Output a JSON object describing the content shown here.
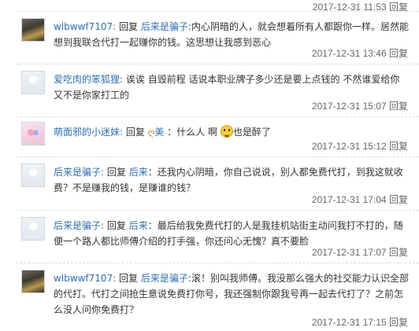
{
  "top_timestamp": "2017-12-31 11:53 回复",
  "replies": [
    {
      "user": "wlbwwf7107:",
      "verb": "回复",
      "target": "后来是骗子",
      "target_suffix": ":",
      "text": "内心阴暗的人，就会想着所有人都跟你一样。居然能想到我联合代打一起赚你的钱。这思想让我感到恶心",
      "time": "2017-12-31 13:46 回复"
    },
    {
      "user": "爱吃肉的笨狐狸:",
      "text": "诶诶 自毁前程 话说本职业牌子多少还是要上点钱的 不然谁爱给你 又不是你家打工的",
      "time": "2017-12-31 15:07 回复"
    },
    {
      "user": "萌面邪的小迷妹:",
      "verb": "回复",
      "target": "美",
      "target_suffix": "：什么人 啊",
      "text_after": "也是醉了",
      "time": "2017-12-31 15:12 回复"
    },
    {
      "user": "后来是骗子:",
      "verb": "回复",
      "target": "后来",
      "target_suffix": "：",
      "text": "还我内心阴暗，你自己说说，别人都免费代打，到我这就收费？不是赚我的钱，是赚谁的钱？",
      "time": "2017-12-31 17:04 回复"
    },
    {
      "user": "后来是骗子:",
      "verb": "回复",
      "target": "后来",
      "target_suffix": "：",
      "text": "最后给我免费代打的人是我挂机站街主动问我打不打的，随便一个路人都比师傅介绍的打手强，你还问心无愧？真不要脸",
      "time": "2017-12-31 17:07 回复"
    },
    {
      "user": "wlbwwf7107:",
      "verb": "回复",
      "target": "后来是骗子",
      "target_suffix": ":",
      "text": "滚！别叫我师傅。我没那么强大的社交能力认识全部的代打。代打之间抢生意说免费打你号，我还强制你跟我号再一起去代打了？之前怎么没人问你免费打？",
      "time": "2017-12-31 17:15 回复"
    }
  ]
}
